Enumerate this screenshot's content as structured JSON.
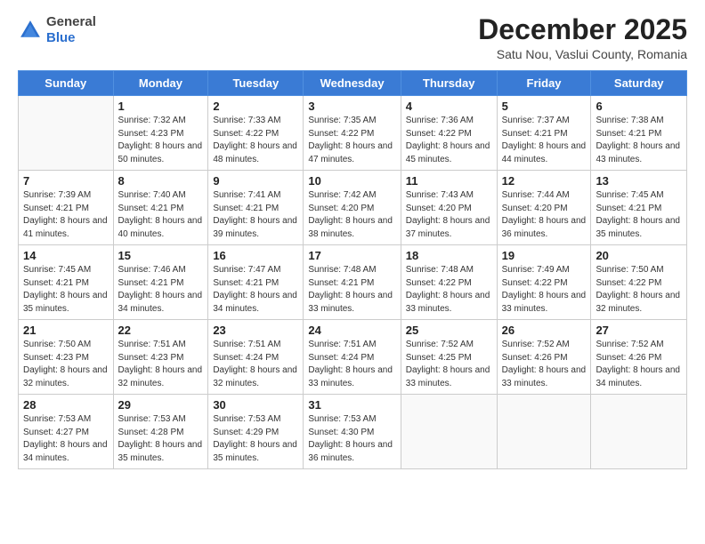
{
  "header": {
    "logo_general": "General",
    "logo_blue": "Blue",
    "month_title": "December 2025",
    "subtitle": "Satu Nou, Vaslui County, Romania"
  },
  "days_of_week": [
    "Sunday",
    "Monday",
    "Tuesday",
    "Wednesday",
    "Thursday",
    "Friday",
    "Saturday"
  ],
  "weeks": [
    [
      {
        "day": "",
        "info": ""
      },
      {
        "day": "1",
        "info": "Sunrise: 7:32 AM\nSunset: 4:23 PM\nDaylight: 8 hours\nand 50 minutes."
      },
      {
        "day": "2",
        "info": "Sunrise: 7:33 AM\nSunset: 4:22 PM\nDaylight: 8 hours\nand 48 minutes."
      },
      {
        "day": "3",
        "info": "Sunrise: 7:35 AM\nSunset: 4:22 PM\nDaylight: 8 hours\nand 47 minutes."
      },
      {
        "day": "4",
        "info": "Sunrise: 7:36 AM\nSunset: 4:22 PM\nDaylight: 8 hours\nand 45 minutes."
      },
      {
        "day": "5",
        "info": "Sunrise: 7:37 AM\nSunset: 4:21 PM\nDaylight: 8 hours\nand 44 minutes."
      },
      {
        "day": "6",
        "info": "Sunrise: 7:38 AM\nSunset: 4:21 PM\nDaylight: 8 hours\nand 43 minutes."
      }
    ],
    [
      {
        "day": "7",
        "info": "Sunrise: 7:39 AM\nSunset: 4:21 PM\nDaylight: 8 hours\nand 41 minutes."
      },
      {
        "day": "8",
        "info": "Sunrise: 7:40 AM\nSunset: 4:21 PM\nDaylight: 8 hours\nand 40 minutes."
      },
      {
        "day": "9",
        "info": "Sunrise: 7:41 AM\nSunset: 4:21 PM\nDaylight: 8 hours\nand 39 minutes."
      },
      {
        "day": "10",
        "info": "Sunrise: 7:42 AM\nSunset: 4:20 PM\nDaylight: 8 hours\nand 38 minutes."
      },
      {
        "day": "11",
        "info": "Sunrise: 7:43 AM\nSunset: 4:20 PM\nDaylight: 8 hours\nand 37 minutes."
      },
      {
        "day": "12",
        "info": "Sunrise: 7:44 AM\nSunset: 4:20 PM\nDaylight: 8 hours\nand 36 minutes."
      },
      {
        "day": "13",
        "info": "Sunrise: 7:45 AM\nSunset: 4:21 PM\nDaylight: 8 hours\nand 35 minutes."
      }
    ],
    [
      {
        "day": "14",
        "info": "Sunrise: 7:45 AM\nSunset: 4:21 PM\nDaylight: 8 hours\nand 35 minutes."
      },
      {
        "day": "15",
        "info": "Sunrise: 7:46 AM\nSunset: 4:21 PM\nDaylight: 8 hours\nand 34 minutes."
      },
      {
        "day": "16",
        "info": "Sunrise: 7:47 AM\nSunset: 4:21 PM\nDaylight: 8 hours\nand 34 minutes."
      },
      {
        "day": "17",
        "info": "Sunrise: 7:48 AM\nSunset: 4:21 PM\nDaylight: 8 hours\nand 33 minutes."
      },
      {
        "day": "18",
        "info": "Sunrise: 7:48 AM\nSunset: 4:22 PM\nDaylight: 8 hours\nand 33 minutes."
      },
      {
        "day": "19",
        "info": "Sunrise: 7:49 AM\nSunset: 4:22 PM\nDaylight: 8 hours\nand 33 minutes."
      },
      {
        "day": "20",
        "info": "Sunrise: 7:50 AM\nSunset: 4:22 PM\nDaylight: 8 hours\nand 32 minutes."
      }
    ],
    [
      {
        "day": "21",
        "info": "Sunrise: 7:50 AM\nSunset: 4:23 PM\nDaylight: 8 hours\nand 32 minutes."
      },
      {
        "day": "22",
        "info": "Sunrise: 7:51 AM\nSunset: 4:23 PM\nDaylight: 8 hours\nand 32 minutes."
      },
      {
        "day": "23",
        "info": "Sunrise: 7:51 AM\nSunset: 4:24 PM\nDaylight: 8 hours\nand 32 minutes."
      },
      {
        "day": "24",
        "info": "Sunrise: 7:51 AM\nSunset: 4:24 PM\nDaylight: 8 hours\nand 33 minutes."
      },
      {
        "day": "25",
        "info": "Sunrise: 7:52 AM\nSunset: 4:25 PM\nDaylight: 8 hours\nand 33 minutes."
      },
      {
        "day": "26",
        "info": "Sunrise: 7:52 AM\nSunset: 4:26 PM\nDaylight: 8 hours\nand 33 minutes."
      },
      {
        "day": "27",
        "info": "Sunrise: 7:52 AM\nSunset: 4:26 PM\nDaylight: 8 hours\nand 34 minutes."
      }
    ],
    [
      {
        "day": "28",
        "info": "Sunrise: 7:53 AM\nSunset: 4:27 PM\nDaylight: 8 hours\nand 34 minutes."
      },
      {
        "day": "29",
        "info": "Sunrise: 7:53 AM\nSunset: 4:28 PM\nDaylight: 8 hours\nand 35 minutes."
      },
      {
        "day": "30",
        "info": "Sunrise: 7:53 AM\nSunset: 4:29 PM\nDaylight: 8 hours\nand 35 minutes."
      },
      {
        "day": "31",
        "info": "Sunrise: 7:53 AM\nSunset: 4:30 PM\nDaylight: 8 hours\nand 36 minutes."
      },
      {
        "day": "",
        "info": ""
      },
      {
        "day": "",
        "info": ""
      },
      {
        "day": "",
        "info": ""
      }
    ]
  ]
}
